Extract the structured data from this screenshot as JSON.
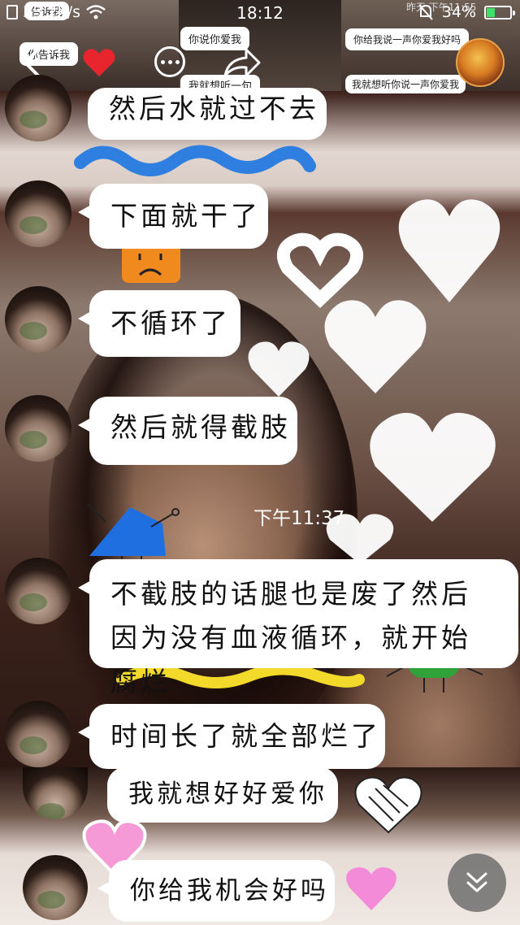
{
  "status_bar": {
    "network_speed": "35.2K/s",
    "time": "18:12",
    "battery": "34%",
    "battery_level": 0.34
  },
  "nav": {
    "back_icon": "chevron-left-icon",
    "favorite_icon": "heart-icon",
    "more_icon": "more-dots-icon",
    "share_icon": "share-arrow-icon"
  },
  "header_snippets": {
    "left_1": "告诉我",
    "left_2": "你告诉我",
    "center_1": "你说你爱我",
    "center_2": "我就想听一句",
    "right_1": "你给我说一声你爱我好吗",
    "right_2": "我就想听你说一声你爱我",
    "right_time": "昨天 下午11:55"
  },
  "messages": [
    {
      "text": "然后水就过不去"
    },
    {
      "text": "下面就干了"
    },
    {
      "text": "不循环了"
    },
    {
      "text": "然后就得截肢"
    },
    {
      "text": "不截肢的话腿也是废了然后因为没有血液循环，就开始腐烂"
    },
    {
      "text": "时间长了就全部烂了"
    },
    {
      "text": "我就想好好爱你"
    },
    {
      "text": "你给我机会好吗"
    }
  ],
  "timestamp": "下午11:37",
  "colors": {
    "wavy_blue": "#2f7fe0",
    "wavy_yellow": "#f2d92a",
    "green_highlight": "#5ec46a",
    "heart_pink": "#f59ad6",
    "heart_red": "#e8242c"
  }
}
